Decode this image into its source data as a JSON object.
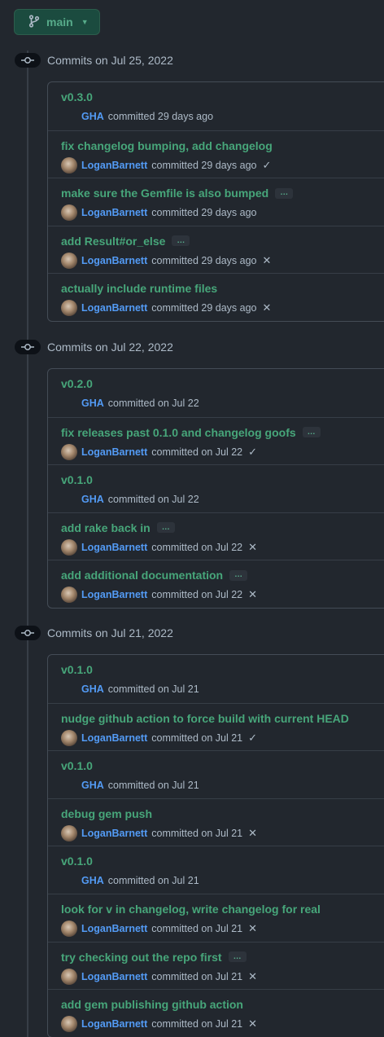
{
  "branch": {
    "name": "main",
    "icon": "git-branch-icon"
  },
  "groups": [
    {
      "header": "Commits on Jul 25, 2022",
      "commits": [
        {
          "title": "v0.3.0",
          "author": "GHA",
          "meta": "committed 29 days ago",
          "avatar": false,
          "ellipsis": false,
          "status": ""
        },
        {
          "title": "fix changelog bumping, add changelog",
          "author": "LoganBarnett",
          "meta": "committed 29 days ago",
          "avatar": true,
          "ellipsis": false,
          "status": "check"
        },
        {
          "title": "make sure the Gemfile is also bumped",
          "author": "LoganBarnett",
          "meta": "committed 29 days ago",
          "avatar": true,
          "ellipsis": true,
          "status": ""
        },
        {
          "title": "add Result#or_else",
          "author": "LoganBarnett",
          "meta": "committed 29 days ago",
          "avatar": true,
          "ellipsis": true,
          "status": "x"
        },
        {
          "title": "actually include runtime files",
          "author": "LoganBarnett",
          "meta": "committed 29 days ago",
          "avatar": true,
          "ellipsis": false,
          "status": "x"
        }
      ]
    },
    {
      "header": "Commits on Jul 22, 2022",
      "commits": [
        {
          "title": "v0.2.0",
          "author": "GHA",
          "meta": "committed on Jul 22",
          "avatar": false,
          "ellipsis": false,
          "status": ""
        },
        {
          "title": "fix releases past 0.1.0 and changelog goofs",
          "author": "LoganBarnett",
          "meta": "committed on Jul 22",
          "avatar": true,
          "ellipsis": true,
          "status": "check"
        },
        {
          "title": "v0.1.0",
          "author": "GHA",
          "meta": "committed on Jul 22",
          "avatar": false,
          "ellipsis": false,
          "status": ""
        },
        {
          "title": "add rake back in",
          "author": "LoganBarnett",
          "meta": "committed on Jul 22",
          "avatar": true,
          "ellipsis": true,
          "status": "x"
        },
        {
          "title": "add additional documentation",
          "author": "LoganBarnett",
          "meta": "committed on Jul 22",
          "avatar": true,
          "ellipsis": true,
          "status": "x"
        }
      ]
    },
    {
      "header": "Commits on Jul 21, 2022",
      "commits": [
        {
          "title": "v0.1.0",
          "author": "GHA",
          "meta": "committed on Jul 21",
          "avatar": false,
          "ellipsis": false,
          "status": ""
        },
        {
          "title": "nudge github action to force build with current HEAD",
          "author": "LoganBarnett",
          "meta": "committed on Jul 21",
          "avatar": true,
          "ellipsis": false,
          "status": "check"
        },
        {
          "title": "v0.1.0",
          "author": "GHA",
          "meta": "committed on Jul 21",
          "avatar": false,
          "ellipsis": false,
          "status": ""
        },
        {
          "title": "debug gem push",
          "author": "LoganBarnett",
          "meta": "committed on Jul 21",
          "avatar": true,
          "ellipsis": false,
          "status": "x"
        },
        {
          "title": "v0.1.0",
          "author": "GHA",
          "meta": "committed on Jul 21",
          "avatar": false,
          "ellipsis": false,
          "status": ""
        },
        {
          "title": "look for v in changelog, write changelog for real",
          "author": "LoganBarnett",
          "meta": "committed on Jul 21",
          "avatar": true,
          "ellipsis": false,
          "status": "x"
        },
        {
          "title": "try checking out the repo first",
          "author": "LoganBarnett",
          "meta": "committed on Jul 21",
          "avatar": true,
          "ellipsis": true,
          "status": "x"
        },
        {
          "title": "add gem publishing github action",
          "author": "LoganBarnett",
          "meta": "committed on Jul 21",
          "avatar": true,
          "ellipsis": false,
          "status": "x"
        }
      ]
    }
  ],
  "ellipsis_text": "…",
  "status_icons": {
    "check": "✓",
    "x": "✕"
  },
  "colors": {
    "accent_green": "#47a67a",
    "author_blue": "#539bf5",
    "background": "#22272e"
  }
}
